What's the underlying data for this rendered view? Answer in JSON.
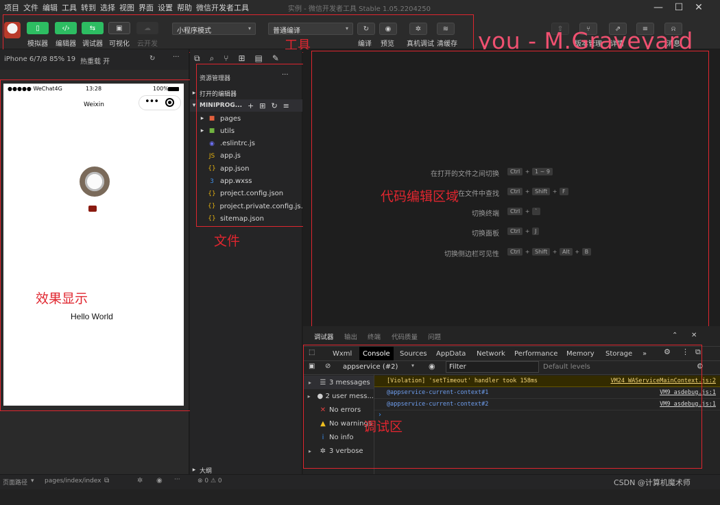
{
  "menu": [
    "项目",
    "文件",
    "编辑",
    "工具",
    "转到",
    "选择",
    "视图",
    "界面",
    "设置",
    "帮助",
    "微信开发者工具"
  ],
  "window_title": "实例 - 微信开发者工具 Stable 1.05.2204250",
  "window_controls": {
    "minimize": "—",
    "maximize": "☐",
    "close": "✕"
  },
  "toolbar": {
    "buttons": [
      {
        "label": "模拟器",
        "icon": "phone-icon",
        "glyph": "▯"
      },
      {
        "label": "编辑器",
        "icon": "code-icon",
        "glyph": "‹/›"
      },
      {
        "label": "调试器",
        "icon": "debug-icon",
        "glyph": "⇆"
      },
      {
        "label": "可视化",
        "icon": "layout-icon",
        "glyph": "▣"
      },
      {
        "label": "云开发",
        "icon": "cloud-icon",
        "glyph": "☁"
      }
    ],
    "mode_select": "小程序模式",
    "compile_select": "普通编译",
    "actions": [
      {
        "label": "编译",
        "icon": "refresh-icon",
        "glyph": "↻"
      },
      {
        "label": "预览",
        "icon": "eye-icon",
        "glyph": "◉"
      },
      {
        "label": "真机调试",
        "icon": "bug-icon",
        "glyph": "✲"
      },
      {
        "label": "清缓存",
        "icon": "layers-icon",
        "glyph": "≋"
      }
    ],
    "right_labels": [
      "版本管理",
      "详情",
      "消息"
    ]
  },
  "annotations": {
    "toolbar": "工具",
    "editor": "代码编辑区域",
    "files": "文件",
    "simulator": "效果显示",
    "debug": "调试区",
    "watermark": "you - M.Graveyard"
  },
  "simulator": {
    "device_select": "iPhone 6/7/8 85% 19",
    "hotreload": "热重载 开",
    "status_carrier": "●●●●● WeChat4G",
    "status_time": "13:28",
    "status_battery": "100%",
    "nav_title": "Weixin",
    "hello": "Hello World"
  },
  "explorer": {
    "title": "资源管理器",
    "open_editors": "打开的编辑器",
    "project": "MINIPROG...",
    "items": [
      {
        "name": "pages",
        "icon": "folder-pages-icon",
        "glyph": "▸",
        "color": "#e2603d"
      },
      {
        "name": "utils",
        "icon": "folder-utils-icon",
        "glyph": "▸",
        "color": "#71b340"
      },
      {
        "name": ".eslintrc.js",
        "icon": "eslint-icon",
        "glyph": "◉",
        "color": "#6b6ff0"
      },
      {
        "name": "app.js",
        "icon": "js-icon",
        "glyph": "JS",
        "color": "#e5b20f"
      },
      {
        "name": "app.json",
        "icon": "json-icon",
        "glyph": "{}",
        "color": "#e5b20f"
      },
      {
        "name": "app.wxss",
        "icon": "wxss-icon",
        "glyph": "3",
        "color": "#3f8ee6"
      },
      {
        "name": "project.config.json",
        "icon": "json-icon",
        "glyph": "{}",
        "color": "#e5b20f"
      },
      {
        "name": "project.private.config.js...",
        "icon": "json-icon",
        "glyph": "{}",
        "color": "#e5b20f"
      },
      {
        "name": "sitemap.json",
        "icon": "json-icon",
        "glyph": "{}",
        "color": "#e5b20f"
      }
    ],
    "outline": "大纲"
  },
  "editor_hints": [
    {
      "label": "在打开的文件之间切换",
      "keys": [
        "Ctrl",
        "1 ~ 9"
      ]
    },
    {
      "label": "在文件中查找",
      "keys": [
        "Ctrl",
        "Shift",
        "F"
      ]
    },
    {
      "label": "切换终端",
      "keys": [
        "Ctrl",
        "`"
      ]
    },
    {
      "label": "切换面板",
      "keys": [
        "Ctrl",
        "J"
      ]
    },
    {
      "label": "切换侧边栏可见性",
      "keys": [
        "Ctrl",
        "Shift",
        "Alt",
        "B"
      ]
    }
  ],
  "debug": {
    "top_tabs": [
      "调试器",
      "输出",
      "终端",
      "代码质量",
      "问题"
    ],
    "tabs": [
      "Wxml",
      "Console",
      "Sources",
      "AppData",
      "Network",
      "Performance",
      "Memory",
      "Storage",
      "»"
    ],
    "active_tab": "Console",
    "context": "appservice (#2)",
    "filter_placeholder": "Filter",
    "levels": "Default levels",
    "sidebar": [
      {
        "label": "3 messages",
        "icon": "list-icon",
        "glyph": "☰",
        "color": "#cfcfcf"
      },
      {
        "label": "2 user mess...",
        "icon": "user-icon",
        "glyph": "●",
        "color": "#cfcfcf"
      },
      {
        "label": "No errors",
        "icon": "error-icon",
        "glyph": "✕",
        "color": "#e34040"
      },
      {
        "label": "No warnings",
        "icon": "warning-icon",
        "glyph": "▲",
        "color": "#f0c020"
      },
      {
        "label": "No info",
        "icon": "info-icon",
        "glyph": "i",
        "color": "#3a8ef0"
      },
      {
        "label": "3 verbose",
        "icon": "verbose-icon",
        "glyph": "✲",
        "color": "#cfcfcf"
      }
    ],
    "logs": [
      {
        "text": "[Violation] 'setTimeout' handler took 158ms",
        "source": "VM24 WAServiceMainContext.js:2",
        "kind": "warn"
      },
      {
        "text": "@appservice-current-context#1",
        "source": "VM9 asdebug.js:1",
        "kind": "link"
      },
      {
        "text": "@appservice-current-context#2",
        "source": "VM9 asdebug.js:1",
        "kind": "link"
      }
    ],
    "prompt": "›"
  },
  "status": {
    "path_label": "页面路径",
    "path": "pages/index/index",
    "errors": "⊗ 0 ⚠ 0",
    "credit": "CSDN @计算机魔术师"
  }
}
